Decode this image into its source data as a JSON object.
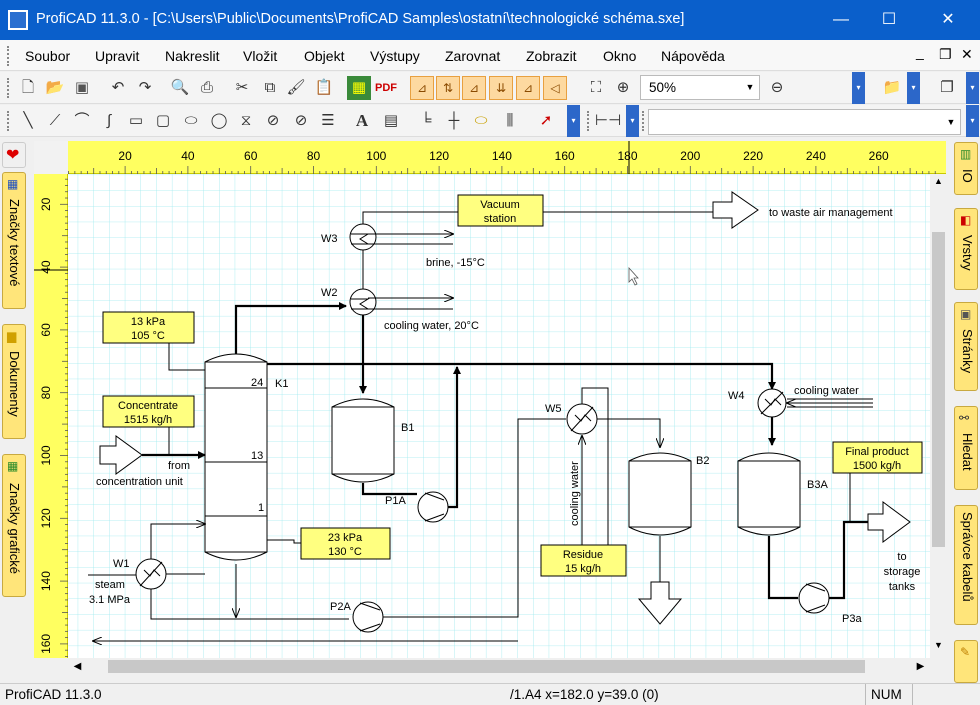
{
  "window": {
    "title": "ProfiCAD 11.3.0 - [C:\\Users\\Public\\Documents\\ProfiCAD Samples\\ostatní\\technologické schéma.sxe]",
    "min_glyph": "—",
    "max_glyph": "☐",
    "close_glyph": "✕"
  },
  "menu": [
    "Soubor",
    "Upravit",
    "Nakreslit",
    "Vložit",
    "Objekt",
    "Výstupy",
    "Zarovnat",
    "Zobrazit",
    "Okno",
    "Nápověda"
  ],
  "mdi": {
    "min": "_",
    "restore": "❐",
    "close": "✕"
  },
  "toolbar1": {
    "zoom_value": "50%",
    "icons": [
      "new-icon",
      "open-icon",
      "save-icon",
      "undo-icon",
      "redo-icon",
      "print-preview-icon",
      "print-icon",
      "cut-icon",
      "copy-icon",
      "format-painter-icon",
      "paste-icon",
      "export-image-icon",
      "export-pdf-icon",
      "align-icons",
      "fit-icon",
      "zoom-in-icon",
      "zoom-out-icon",
      "folder-icon",
      "pages-icon"
    ],
    "pdf_label": "PDF"
  },
  "toolbar2": {
    "icons": [
      "line-icon",
      "polyline-icon",
      "arc-icon",
      "bezier-icon",
      "rectangle-icon",
      "rounded-rect-icon",
      "ellipse-icon",
      "circle-icon",
      "image-icon",
      "hatch-icon",
      "text-icon",
      "textbox-icon",
      "wire-icon",
      "node-icon",
      "label-icon",
      "bus-icon",
      "select-arrow-icon",
      "dimension-icon"
    ],
    "text_label": "A"
  },
  "left_tabs": [
    "Značky textové",
    "Dokumenty",
    "Značky grafické"
  ],
  "right_tabs": [
    "IO",
    "Vrstvy",
    "Stránky",
    "Hledat",
    "Správce kabelů"
  ],
  "ruler": {
    "h": [
      "20",
      "40",
      "60",
      "80",
      "100",
      "120",
      "140",
      "160",
      "180",
      "200",
      "220",
      "240",
      "260"
    ],
    "v": [
      "20",
      "40",
      "60",
      "80",
      "100",
      "120",
      "140",
      "160"
    ]
  },
  "diagram": {
    "vacuum": [
      "Vacuum",
      "station"
    ],
    "waste_air": "to waste air management",
    "brine": "brine, -15°C",
    "cooling20": "cooling water, 20°C",
    "kpa13": [
      "13 kPa",
      "105 °C"
    ],
    "concentrate": [
      "Concentrate",
      "1515 kg/h"
    ],
    "from": "from",
    "conc_unit": "concentration unit",
    "kpa23": [
      "23 kPa",
      "130 °C"
    ],
    "steam": [
      "steam",
      "3.1 MPa"
    ],
    "residue": [
      "Residue",
      "15 kg/h"
    ],
    "final": [
      "Final product",
      "1500 kg/h"
    ],
    "to_storage": [
      "to",
      "storage",
      "tanks"
    ],
    "cooling_water": "cooling water",
    "cooling_water_v": "cooling water",
    "labels": {
      "W1": "W1",
      "W2": "W2",
      "W3": "W3",
      "W4": "W4",
      "W5": "W5",
      "K1": "K1",
      "B1": "B1",
      "B2": "B2",
      "B3A": "B3A",
      "P1A": "P1A",
      "P2A": "P2A",
      "P3a": "P3a",
      "t24": "24",
      "t13": "13",
      "t1": "1"
    }
  },
  "status": {
    "app": "ProfiCAD 11.3.0",
    "position": "/1.A4  x=182.0  y=39.0 (0)",
    "num": "NUM"
  },
  "colors": {
    "titlebar": "#0a5fcb",
    "ruler": "#ffff60",
    "label_box": "#ffff80",
    "grid": "#6fe0e8"
  }
}
